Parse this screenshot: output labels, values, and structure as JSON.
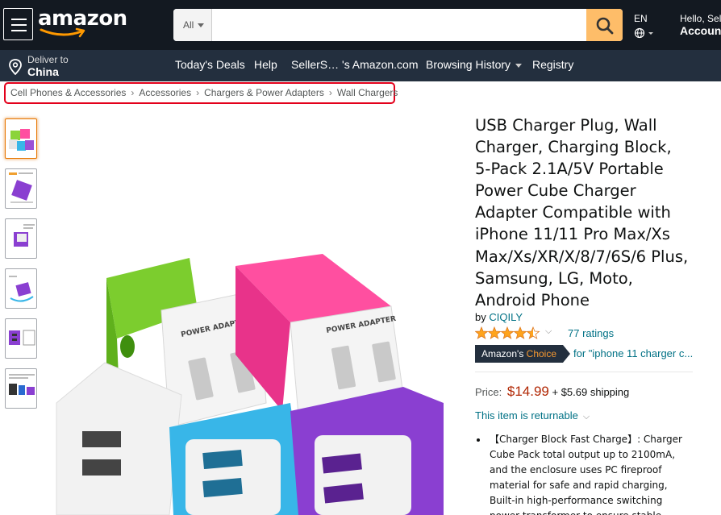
{
  "header": {
    "logo_text": "amazon",
    "search": {
      "category": "All",
      "placeholder": "",
      "value": ""
    },
    "language": "EN",
    "account_line1": "Hello, Sel",
    "account_line2": "Account"
  },
  "subnav": {
    "deliver_line1": "Deliver to",
    "deliver_line2": "China",
    "items": [
      "Today's Deals",
      "Help",
      "SellerS… 's Amazon.com",
      "Browsing History",
      "Registry"
    ]
  },
  "breadcrumb": [
    "Cell Phones & Accessories",
    "Accessories",
    "Chargers & Power Adapters",
    "Wall Chargers"
  ],
  "product": {
    "title": "USB Charger Plug, Wall Charger, Charging Block, 5-Pack 2.1A/5V Portable Power Cube Charger Adapter Compatible with iPhone 11/11 Pro Max/Xs Max/Xs/XR/X/8/7/6S/6 Plus, Samsung, LG, Moto, Android Phone",
    "by_label": "by",
    "brand": "CIQILY",
    "rating": 4.5,
    "ratings_count": "77 ratings",
    "choice_prefix": "Amazon's",
    "choice_word": "Choice",
    "choice_for": "for \"iphone 11 charger c...",
    "price_label": "Price:",
    "price": "$14.99",
    "shipping": "+ $5.69 shipping",
    "returnable": "This item is returnable",
    "bullet": "【Charger Block Fast Charge】: Charger Cube Pack total output up to 2100mA, and the enclosure uses PC fireproof material for safe and rapid charging, Built-in high-performance switching power transformer to ensure stable voltage"
  },
  "image_text": {
    "label1": "POWER ADAPTER",
    "label2": "POWER ADAPTER"
  },
  "colors": {
    "nav_dark": "#131921",
    "nav_sub": "#232f3e",
    "search_button": "#febd69",
    "link": "#007185",
    "price": "#b12704",
    "star": "#ffa41c",
    "breadcrumb_highlight": "#e3001b"
  }
}
